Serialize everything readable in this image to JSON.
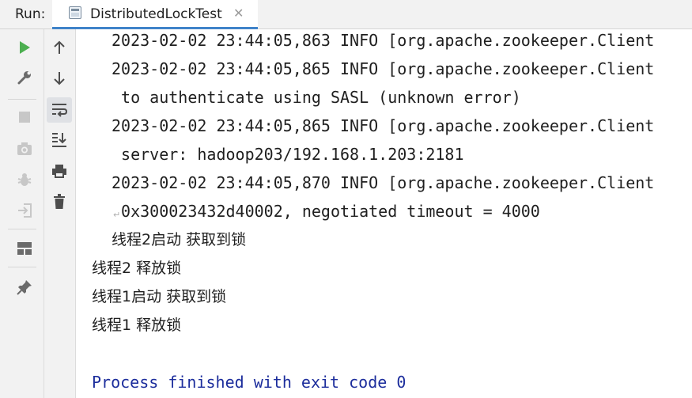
{
  "header": {
    "run_label": "Run:",
    "tab_title": "DistributedLockTest",
    "close_glyph": "✕"
  },
  "toolbar_left": [
    {
      "name": "rerun-icon",
      "color": "#4caf50"
    },
    {
      "name": "wrench-icon",
      "color": "#6b6b6b"
    },
    {
      "name": "stop-icon",
      "color": "#c7c7c7"
    },
    {
      "name": "camera-icon",
      "color": "#c7c7c7"
    },
    {
      "name": "debug-bug-icon",
      "color": "#c7c7c7"
    },
    {
      "name": "exit-icon",
      "color": "#c7c7c7"
    },
    {
      "name": "layout-icon",
      "color": "#6b6b6b"
    },
    {
      "name": "pin-icon",
      "color": "#6b6b6b"
    }
  ],
  "toolbar_right": [
    {
      "name": "arrow-up-icon"
    },
    {
      "name": "arrow-down-icon"
    },
    {
      "name": "soft-wrap-icon",
      "active": true
    },
    {
      "name": "scroll-to-end-icon"
    },
    {
      "name": "print-icon"
    },
    {
      "name": "trash-icon"
    }
  ],
  "console": {
    "lines": [
      "2023-02-02 23:44:05,863 INFO [org.apache.zookeeper.Client",
      "2023-02-02 23:44:05,865 INFO [org.apache.zookeeper.Client",
      " to authenticate using SASL (unknown error)",
      "2023-02-02 23:44:05,865 INFO [org.apache.zookeeper.Client",
      " server: hadoop203/192.168.1.203:2181",
      "2023-02-02 23:44:05,870 INFO [org.apache.zookeeper.Client",
      " 0x300023432d40002, negotiated timeout = 4000",
      "线程2启动 获取到锁",
      "线程2 释放锁",
      "线程1启动 获取到锁",
      "线程1 释放锁"
    ],
    "exit_line": "Process finished with exit code 0",
    "text_color": "#1f1f1f",
    "exit_color": "#1c2d9c"
  }
}
